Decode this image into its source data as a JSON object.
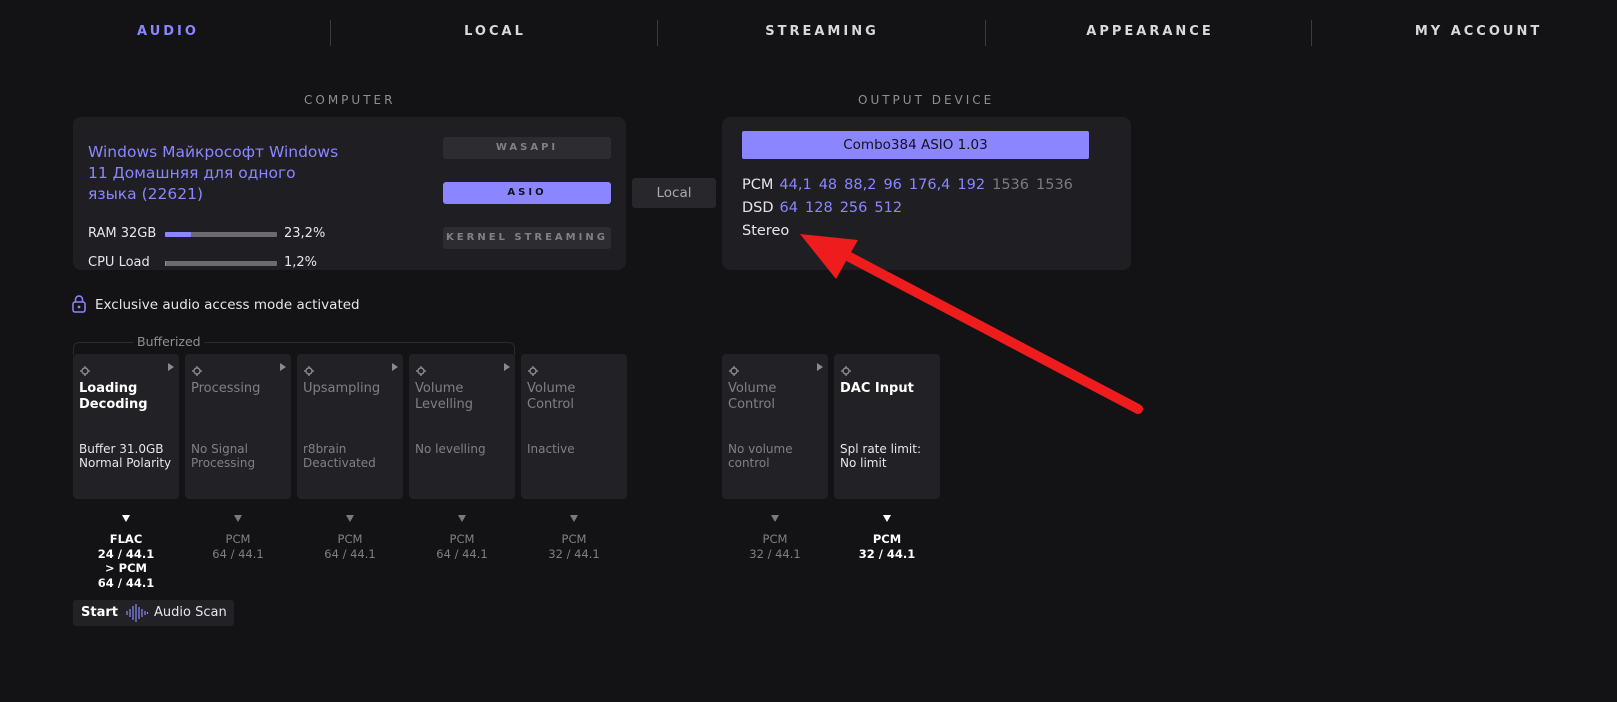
{
  "nav": {
    "tabs": [
      {
        "label": "AUDIO",
        "active": true
      },
      {
        "label": "LOCAL"
      },
      {
        "label": "STREAMING"
      },
      {
        "label": "APPEARANCE"
      },
      {
        "label": "MY ACCOUNT"
      }
    ]
  },
  "computer": {
    "section_label": "COMPUTER",
    "title": "Windows Майкрософт Windows 11 Домашняя для одного языка (22621)",
    "ram": {
      "label": "RAM 32GB",
      "value": "23,2%",
      "fraction": 0.232
    },
    "cpu": {
      "label": "CPU Load",
      "value": "1,2%",
      "fraction": 0.012
    },
    "modes": [
      {
        "label": "WASAPI",
        "active": false
      },
      {
        "label": "ASIO",
        "active": true
      },
      {
        "label": "KERNEL STREAMING",
        "active": false
      }
    ]
  },
  "local_button": "Local",
  "output": {
    "section_label": "OUTPUT DEVICE",
    "device": "Combo384 ASIO 1.03",
    "pcm_label": "PCM",
    "pcm_rates": [
      {
        "v": "44,1"
      },
      {
        "v": "48"
      },
      {
        "v": "88,2"
      },
      {
        "v": "96"
      },
      {
        "v": "176,4"
      },
      {
        "v": "192"
      },
      {
        "v": "1536",
        "dim": true
      },
      {
        "v": "1536",
        "dim": true
      }
    ],
    "dsd_label": "DSD",
    "dsd_rates": [
      {
        "v": "64"
      },
      {
        "v": "128"
      },
      {
        "v": "256"
      },
      {
        "v": "512"
      }
    ],
    "channels": "Stereo"
  },
  "exclusive_text": "Exclusive audio access mode activated",
  "bufferized_label": "Bufferized",
  "pipeline": [
    {
      "title": "Loading Decoding",
      "desc": "Buffer 31.0GB Normal Polarity",
      "bright": true,
      "play": true,
      "flow": "FLAC\n24 / 44.1\n> PCM\n64 / 44.1"
    },
    {
      "title": "Processing",
      "desc": "No Signal Processing",
      "play": true,
      "flow": "PCM\n64 / 44.1"
    },
    {
      "title": "Upsampling",
      "desc": "r8brain Deactivated",
      "play": true,
      "flow": "PCM\n64 / 44.1"
    },
    {
      "title": "Volume Levelling",
      "desc": "No levelling",
      "play": true,
      "flow": "PCM\n64 / 44.1"
    },
    {
      "title": "Volume Control",
      "desc": "Inactive",
      "play": false,
      "flow": "PCM\n32 / 44.1"
    }
  ],
  "output_pipeline": [
    {
      "title": "Volume Control",
      "desc": "No volume control",
      "play": true,
      "flow": "PCM\n32 / 44.1"
    },
    {
      "title": "DAC Input",
      "desc": "Spl rate limit: No limit",
      "bright": true,
      "play": false,
      "flow": "PCM\n32 / 44.1"
    }
  ],
  "audio_scan": {
    "start": "Start",
    "label": "Audio Scan"
  },
  "colors": {
    "accent": "#8b86ff",
    "annotation_arrow": "#ee1c1c"
  }
}
